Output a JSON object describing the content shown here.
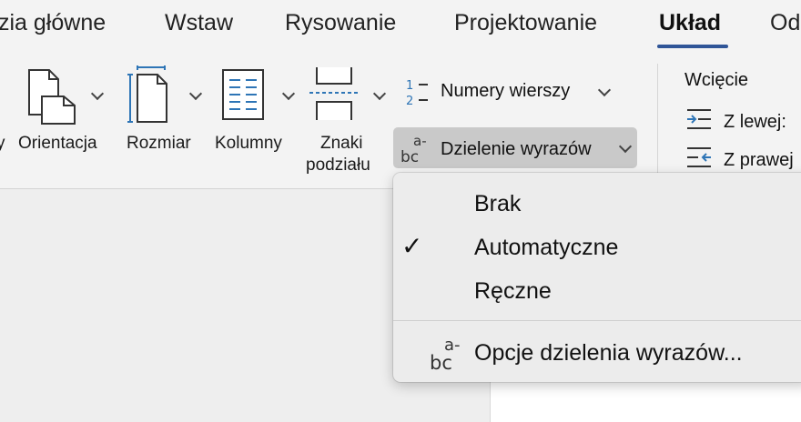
{
  "tabs": [
    {
      "label": "zia główne",
      "active": false
    },
    {
      "label": "Wstaw",
      "active": false
    },
    {
      "label": "Rysowanie",
      "active": false
    },
    {
      "label": "Projektowanie",
      "active": false
    },
    {
      "label": "Układ",
      "active": true
    },
    {
      "label": "Od",
      "active": false
    }
  ],
  "ribbon": {
    "partial_label": "y",
    "orientation_label": "Orientacja",
    "size_label": "Rozmiar",
    "columns_label": "Kolumny",
    "breaks_label_line1": "Znaki",
    "breaks_label_line2": "podziału",
    "line_numbers_label": "Numery wierszy",
    "hyphenation_label": "Dzielenie wyrazów",
    "indent": {
      "title": "Wcięcie",
      "left_label": "Z lewej:",
      "right_label": "Z prawej"
    }
  },
  "hyphenation_menu": {
    "items": [
      {
        "label": "Brak",
        "checked": false
      },
      {
        "label": "Automatyczne",
        "checked": true
      },
      {
        "label": "Ręczne",
        "checked": false
      }
    ],
    "check_glyph": "✓",
    "options_label": "Opcje dzielenia wyrazów..."
  },
  "colors": {
    "accent": "#2f5597",
    "icon_blue": "#2e75b6",
    "button_pressed": "#c9c9c9"
  },
  "icons": [
    "orientation-icon",
    "size-icon",
    "columns-icon",
    "breaks-icon",
    "line-numbers-icon",
    "hyphenation-icon",
    "indent-left-icon",
    "indent-right-icon",
    "checkmark-icon"
  ]
}
